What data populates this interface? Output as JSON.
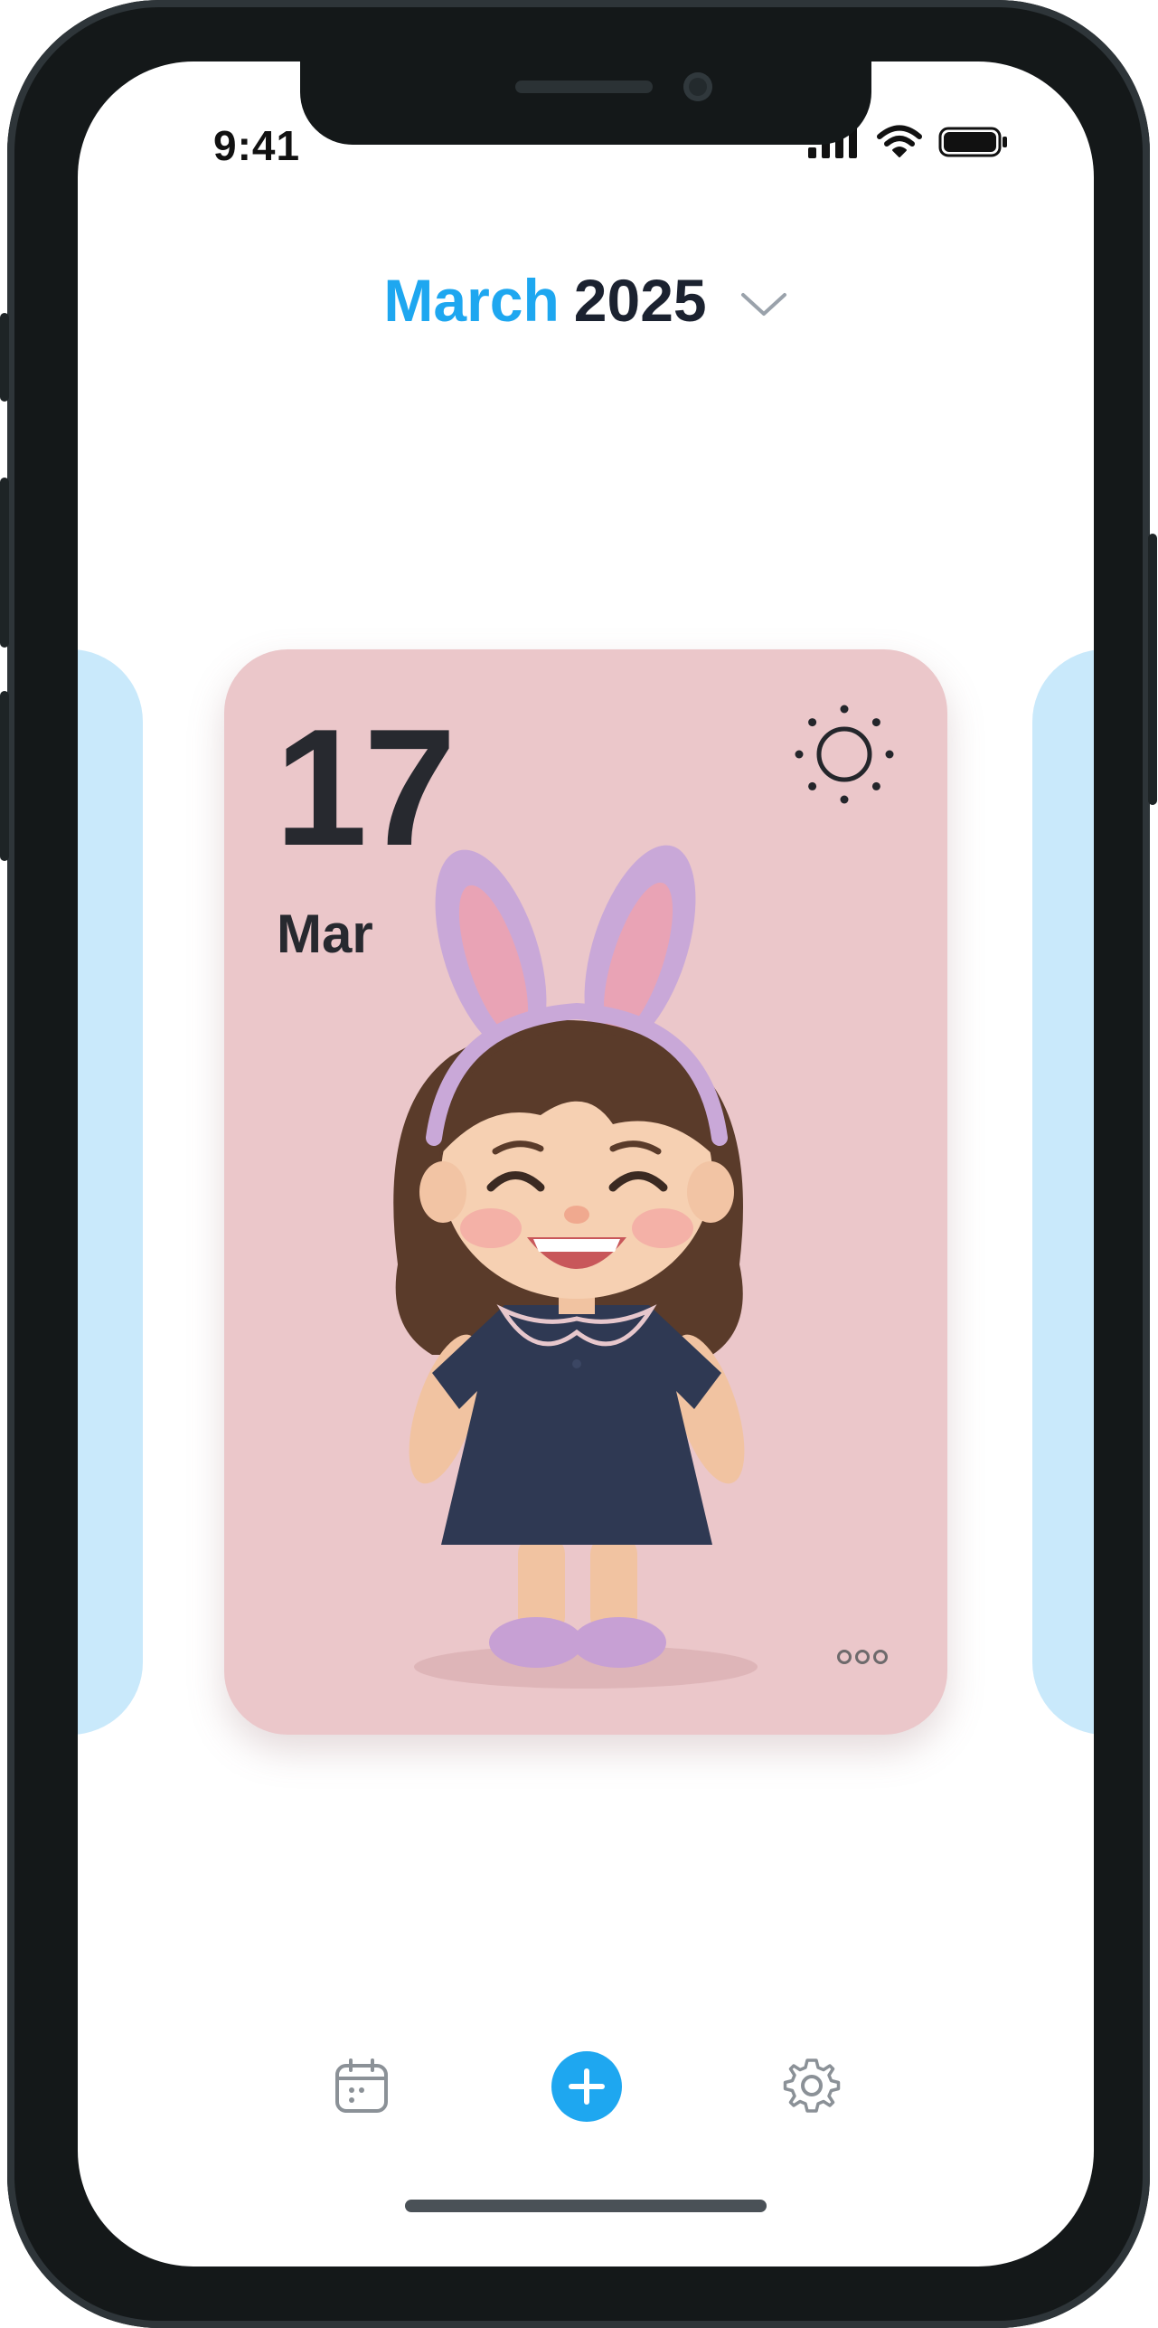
{
  "status_bar": {
    "time": "9:41",
    "icons": [
      "cellular-signal-icon",
      "wifi-icon",
      "battery-icon"
    ]
  },
  "header": {
    "month": "March",
    "year": "2025",
    "picker_icon": "chevron-down-icon"
  },
  "day_card": {
    "day": "17",
    "month_short": "Mar",
    "weather_icon": "sun-icon",
    "image": "clay-girl-with-bunny-ears",
    "menu_icon": "more-dots-icon",
    "background_color": "#ebc7ca"
  },
  "side_cards_color": "#c9e9fb",
  "tab_bar": {
    "items": [
      {
        "icon": "calendar-icon"
      },
      {
        "icon": "plus-icon"
      },
      {
        "icon": "gear-icon"
      }
    ]
  },
  "colors": {
    "accent": "#1ea7f0",
    "text_dark": "#1b2230"
  }
}
